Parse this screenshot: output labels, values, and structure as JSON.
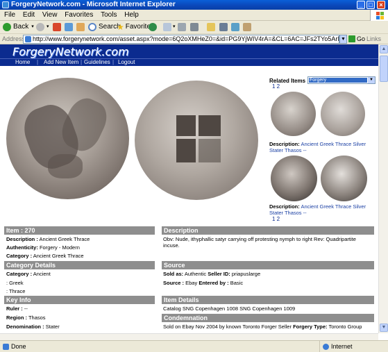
{
  "window": {
    "title": "ForgeryNetwork.com - Microsoft Internet Explorer"
  },
  "menu": [
    "File",
    "Edit",
    "View",
    "Favorites",
    "Tools",
    "Help"
  ],
  "toolbar": {
    "back": "Back",
    "search": "Search",
    "favorites": "Favorites"
  },
  "address": {
    "label": "Address",
    "url": "http://www.forgerynetwork.com/asset.aspx?mode=6Q2oXMHeZ0=&id=PG9YjWIV4rA=&CL=6AC=JFs2TYo5ArM=&CP=&RW=1q~x~rThPtZ6c",
    "go": "Go",
    "links": "Links"
  },
  "site": {
    "logo": "ForgeryNetwork.com",
    "nav": [
      "Home",
      "Add New Item",
      "Guidelines",
      "Logout"
    ]
  },
  "related": {
    "label": "Related Items",
    "selected": "Forgery",
    "pager_top": "1 2",
    "pager_bottom": "1 2",
    "items": [
      {
        "desc_label": "Description:",
        "desc": "Ancient Greek Thrace Silver Stater Thasos --"
      },
      {
        "desc_label": "Description:",
        "desc": "Ancient Greek Thrace Silver Stater Thasos --"
      }
    ]
  },
  "item": {
    "header": "Item : 270",
    "description_label": "Description :",
    "description": "Ancient Greek Thrace",
    "authenticity_label": "Authenticity:",
    "authenticity": "Forgery - Modern",
    "category_label": "Category :",
    "category": "Ancient Greek Thrace"
  },
  "category_details": {
    "header": "Category Details",
    "category_label": "Category :",
    "category": "Ancient",
    "line2": ": Greek",
    "line3": ": Thrace"
  },
  "key_info": {
    "header": "Key Info",
    "ruler_label": "Ruler :",
    "ruler": "--",
    "region_label": "Region :",
    "region": "Thasos",
    "denomination_label": "Denomination :",
    "denomination": "Stater"
  },
  "description": {
    "header": "Description",
    "text1": "Obv: Nude, ithyphallic satyr carrying off protesting nymph to right Rev: Quadripartite",
    "text2": "incuse."
  },
  "source": {
    "header": "Source",
    "sold_as_label": "Sold as:",
    "sold_as": "Authentic",
    "seller_label": "Seller ID:",
    "seller": "priapuslarge",
    "source_label": "Source :",
    "source": "Ebay",
    "entered_label": "Entered by :",
    "entered": "Basic"
  },
  "item_details": {
    "header": "Item Details",
    "text": "Catalog SNG Copenhagen 1008 SNG Copenhagen 1009"
  },
  "condemnation": {
    "header": "Condemnation",
    "text_a": "Sold on Ebay Nov 2004 by known Toronto Forger Seller",
    "type_label": "Forgery Type:",
    "type": "Toronto Group"
  },
  "status": {
    "left": "Done",
    "zone": "Internet"
  },
  "colors": {
    "site_header": "#0b2b8f",
    "panel_header": "#8e8e8e",
    "xp_blue": "#0a5fd8"
  }
}
